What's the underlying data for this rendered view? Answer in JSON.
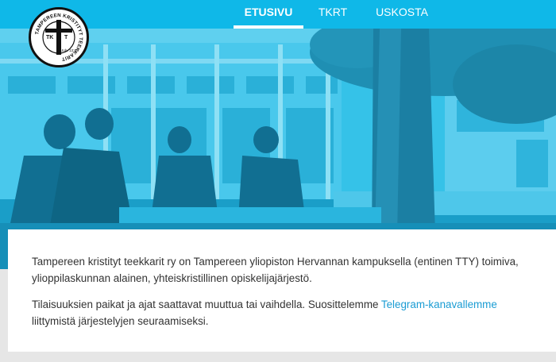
{
  "logo": {
    "ring_text": "TAMPEREEN KRISTITYT TEEKKARIT",
    "monogram_left": "TK",
    "monogram_right": "T",
    "verse": "Joh. 13:35"
  },
  "nav": {
    "items": [
      {
        "label": "ETUSIVU",
        "active": true
      },
      {
        "label": "TKRT",
        "active": false
      },
      {
        "label": "USKOSTA",
        "active": false
      }
    ]
  },
  "content": {
    "intro": "Tampereen kristityt teekkarit ry on Tampereen yliopiston Hervannan kampuksella (entinen TTY) toimiva, ylioppilaskunnan alainen, yhteiskristillinen opiskelijajärjestö.",
    "notice_before": "Tilaisuuksien paikat ja ajat saattavat muuttua tai vaihdella. Suosittelemme ",
    "notice_link": "Telegram-kanavallemme",
    "notice_after": " liittymistä järjestelyjen seuraamiseksi."
  },
  "colors": {
    "nav_bg": "#0fb8e8",
    "hero_tint": "#2cbbe2",
    "link": "#1a9cd3",
    "text": "#333333"
  }
}
